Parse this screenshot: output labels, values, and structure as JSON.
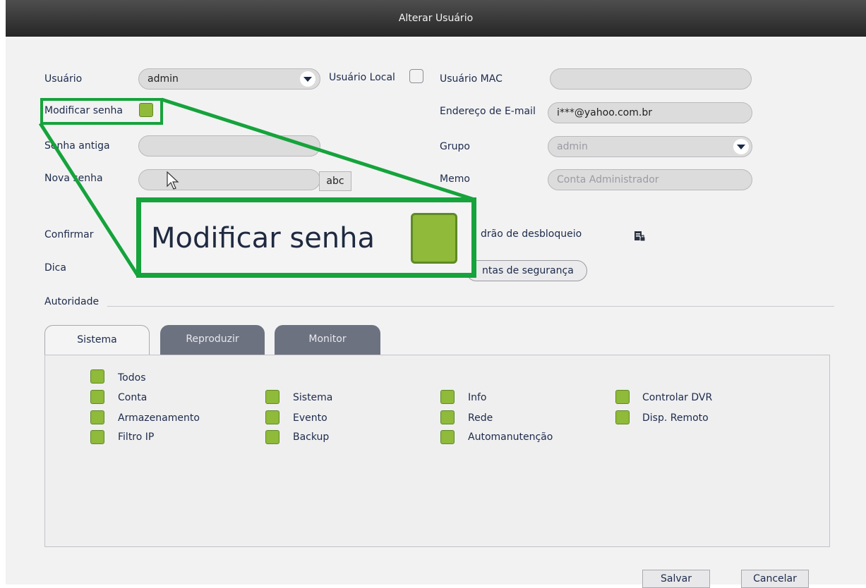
{
  "window": {
    "title": "Alterar Usuário"
  },
  "form": {
    "user_label": "Usuário",
    "user_value": "admin",
    "local_user_label": "Usuário Local",
    "mac_label": "Usuário MAC",
    "mac_value": "",
    "modify_password_label": "Modificar senha",
    "email_label": "Endereço de E-mail",
    "email_value": "i***@yahoo.com.br",
    "old_password_label": "Senha antiga",
    "group_label": "Grupo",
    "group_value": "admin",
    "new_password_label": "Nova senha",
    "abc_button": "abc",
    "memo_label": "Memo",
    "memo_value": "Conta Administrador",
    "confirm_label": "Confirmar",
    "unlock_pattern_label": "drão de desbloqueio",
    "hint_label": "Dica",
    "security_questions_button": "ntas de segurança",
    "authority_label": "Autoridade"
  },
  "zoom": {
    "label": "Modificar senha"
  },
  "tabs": [
    {
      "label": "Sistema",
      "active": true
    },
    {
      "label": "Reproduzir",
      "active": false
    },
    {
      "label": "Monitor",
      "active": false
    }
  ],
  "permissions": {
    "all": "Todos",
    "col1": [
      "Conta",
      "Armazenamento",
      "Filtro IP"
    ],
    "col2": [
      "Sistema",
      "Evento",
      "Backup"
    ],
    "col3": [
      "Info",
      "Rede",
      "Automanutenção"
    ],
    "col4": [
      "Controlar DVR",
      "Disp. Remoto"
    ]
  },
  "buttons": {
    "save": "Salvar",
    "cancel": "Cancelar"
  },
  "colors": {
    "highlight": "#15a33b",
    "checkbox": "#8fba3a",
    "titlebar": "#2f2f2f"
  }
}
